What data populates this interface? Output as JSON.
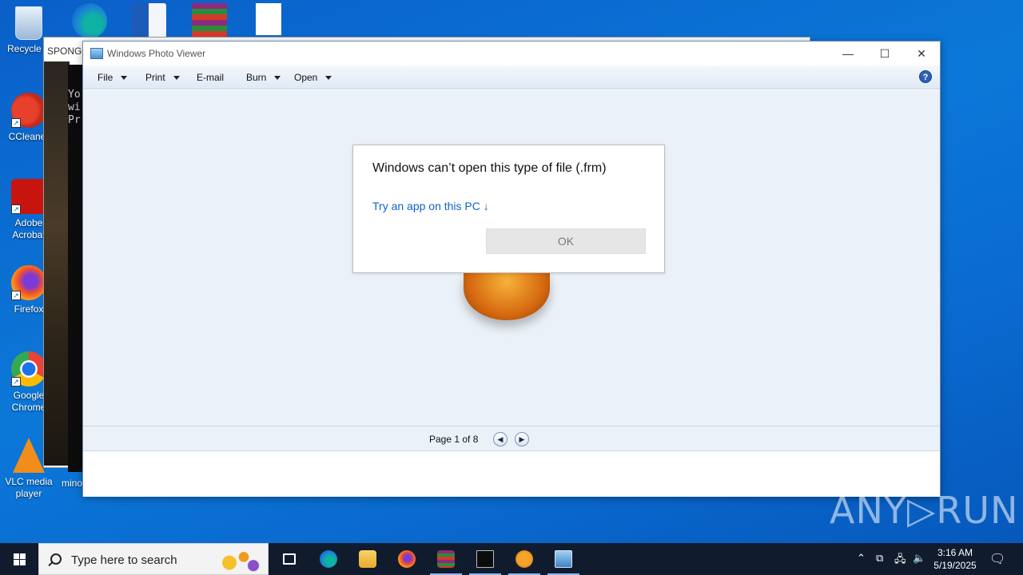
{
  "desktop": {
    "icons": [
      {
        "label": "Recycle B",
        "icon": "recycle-bin-icon"
      },
      {
        "label": "CCleaner",
        "icon": "ccleaner-icon"
      },
      {
        "label": "Adobe Acrobat",
        "icon": "acrobat-icon"
      },
      {
        "label": "Firefox",
        "icon": "firefox-icon"
      },
      {
        "label": "Google Chrome",
        "icon": "chrome-icon"
      },
      {
        "label": "VLC media player",
        "icon": "vlc-icon"
      }
    ],
    "partial_label": "mino",
    "top_icons": [
      "edge-icon",
      "word-icon",
      "winrar-icon",
      "blank-file-icon"
    ]
  },
  "background_window": {
    "title": "SPONGE",
    "console_lines": [
      "Yo",
      "wi",
      "Pr"
    ]
  },
  "photo_viewer": {
    "title": "Windows Photo Viewer",
    "menu": [
      {
        "label": "File",
        "has_caret": true
      },
      {
        "label": "Print",
        "has_caret": true
      },
      {
        "label": "E-mail",
        "has_caret": false
      },
      {
        "label": "Burn",
        "has_caret": true
      },
      {
        "label": "Open",
        "has_caret": true
      }
    ],
    "help_label": "?",
    "page_label": "Page 1 of 8",
    "prev_glyph": "◀",
    "next_glyph": "▶"
  },
  "dialog": {
    "message": "Windows can’t open this type of file (.frm)",
    "link": "Try an app on this PC ↓",
    "ok_label": "OK"
  },
  "watermark": "ANY▷RUN",
  "taskbar": {
    "search_placeholder": "Type here to search",
    "apps": [
      "task-view-icon",
      "edge-icon",
      "file-explorer-icon",
      "firefox-icon",
      "winrar-icon",
      "cmd-icon",
      "pumpkin-app-icon",
      "photo-viewer-icon"
    ],
    "time": "3:16 AM",
    "date": "5/19/2025"
  },
  "colors": {
    "desktop_blue": "#0b78d8",
    "link_blue": "#0f64c8",
    "taskbar": "#101c2e"
  }
}
